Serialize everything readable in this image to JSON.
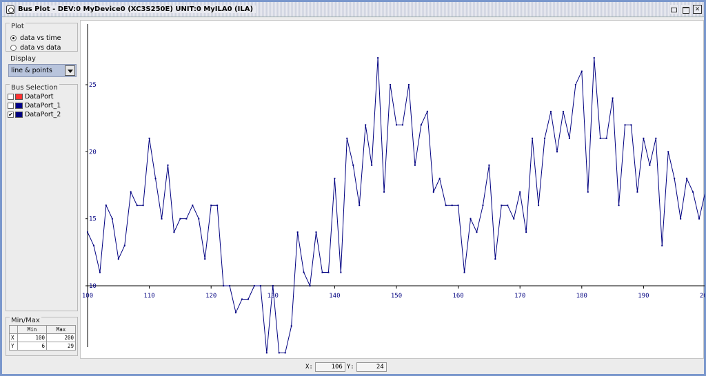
{
  "window": {
    "title": "Bus Plot - DEV:0 MyDevice0 (XC3S250E) UNIT:0 MyILA0 (ILA)"
  },
  "plot_group": {
    "legend": "Plot",
    "options": [
      {
        "label": "data vs time",
        "selected": true
      },
      {
        "label": "data vs data",
        "selected": false
      }
    ]
  },
  "display_group": {
    "legend": "Display",
    "selected": "line & points"
  },
  "bus_group": {
    "legend": "Bus Selection",
    "items": [
      {
        "label": "DataPort",
        "checked": false,
        "color": "#ff3333"
      },
      {
        "label": "DataPort_1",
        "checked": false,
        "color": "#00008b"
      },
      {
        "label": "DataPort_2",
        "checked": true,
        "color": "#000080"
      }
    ]
  },
  "minmax_group": {
    "legend": "Min/Max",
    "headers": [
      "",
      "Min",
      "Max"
    ],
    "rows": [
      {
        "axis": "X",
        "min": "100",
        "max": "200"
      },
      {
        "axis": "Y",
        "min": "6",
        "max": "29"
      }
    ]
  },
  "status": {
    "x_label": "X:",
    "x_value": "106",
    "y_label": "Y:",
    "y_value": "24"
  },
  "chart_data": {
    "type": "line",
    "title": "",
    "xlabel": "",
    "ylabel": "",
    "series": [
      {
        "name": "DataPort_2",
        "color": "#000080",
        "x": [
          100,
          101,
          102,
          103,
          104,
          105,
          106,
          107,
          108,
          109,
          110,
          111,
          112,
          113,
          114,
          115,
          116,
          117,
          118,
          119,
          120,
          121,
          122,
          123,
          124,
          125,
          126,
          127,
          128,
          129,
          130,
          131,
          132,
          133,
          134,
          135,
          136,
          137,
          138,
          139,
          140,
          141,
          142,
          143,
          144,
          145,
          146,
          147,
          148,
          149,
          150,
          151,
          152,
          153,
          154,
          155,
          156,
          157,
          158,
          159,
          160,
          161,
          162,
          163,
          164,
          165,
          166,
          167,
          168,
          169,
          170,
          171,
          172,
          173,
          174,
          175,
          176,
          177,
          178,
          179,
          180,
          181,
          182,
          183,
          184,
          185,
          186,
          187,
          188,
          189,
          190,
          191,
          192,
          193,
          194,
          195,
          196,
          197,
          198,
          199,
          200
        ],
        "values": [
          14,
          13,
          11,
          16,
          15,
          12,
          13,
          17,
          16,
          16,
          21,
          18,
          15,
          19,
          14,
          15,
          15,
          16,
          15,
          12,
          16,
          16,
          10,
          10,
          8,
          9,
          9,
          10,
          10,
          5,
          10,
          5,
          5,
          7,
          14,
          11,
          10,
          14,
          11,
          11,
          18,
          11,
          21,
          19,
          16,
          22,
          19,
          27,
          17,
          25,
          22,
          22,
          25,
          19,
          22,
          23,
          17,
          18,
          16,
          16,
          16,
          11,
          15,
          14,
          16,
          19,
          12,
          16,
          16,
          15,
          17,
          14,
          21,
          16,
          21,
          23,
          20,
          23,
          21,
          25,
          26,
          17,
          27,
          21,
          21,
          24,
          16,
          22,
          22,
          17,
          21,
          19,
          21,
          13,
          20,
          18,
          15,
          18,
          17,
          15,
          17
        ]
      }
    ],
    "xlim": [
      100,
      200
    ],
    "ylim": [
      5,
      28
    ],
    "x_ticks": [
      100,
      110,
      120,
      130,
      140,
      150,
      160,
      170,
      180,
      190,
      200
    ],
    "y_ticks": [
      10,
      15,
      20,
      25
    ],
    "grid": false,
    "legend": "none",
    "tick_color": "#000080"
  }
}
